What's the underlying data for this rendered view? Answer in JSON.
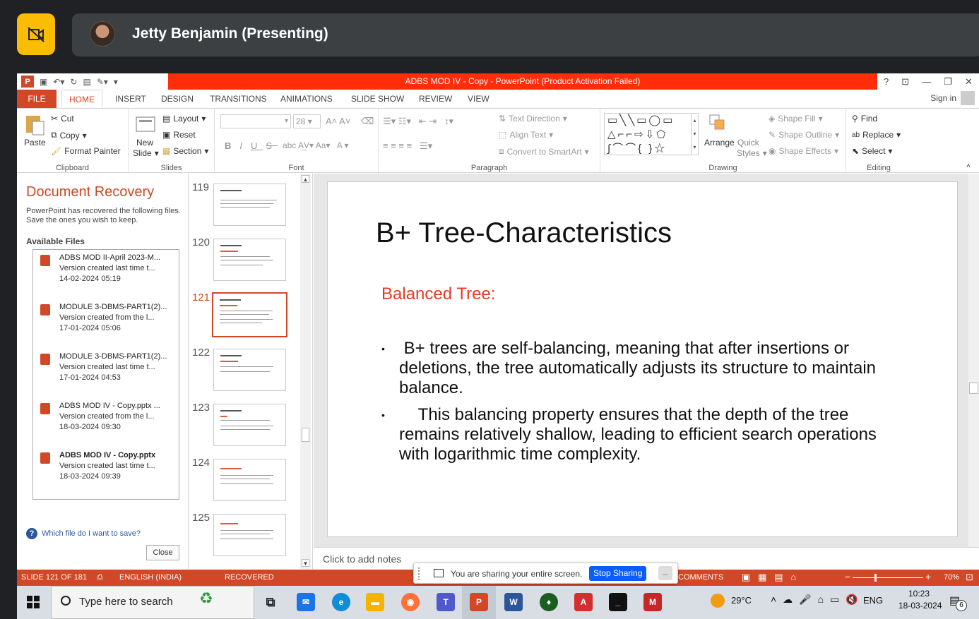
{
  "meeting": {
    "presenter": "Jetty Benjamin (Presenting)"
  },
  "window": {
    "title": "ADBS MOD IV - Copy -  PowerPoint (Product Activation Failed)",
    "help": "?",
    "sign_in": "Sign in"
  },
  "tabs": [
    "FILE",
    "HOME",
    "INSERT",
    "DESIGN",
    "TRANSITIONS",
    "ANIMATIONS",
    "SLIDE SHOW",
    "REVIEW",
    "VIEW"
  ],
  "ribbon": {
    "clipboard": {
      "label": "Clipboard",
      "paste": "Paste",
      "cut": "Cut",
      "copy": "Copy",
      "format_painter": "Format Painter"
    },
    "slides": {
      "label": "Slides",
      "new_slide_1": "New",
      "new_slide_2": "Slide",
      "layout": "Layout",
      "reset": "Reset",
      "section": "Section"
    },
    "font": {
      "label": "Font",
      "size": "28"
    },
    "paragraph": {
      "label": "Paragraph",
      "text_direction": "Text Direction",
      "align_text": "Align Text",
      "convert_smartart": "Convert to SmartArt"
    },
    "drawing": {
      "label": "Drawing",
      "arrange": "Arrange",
      "quick_styles_1": "Quick",
      "quick_styles_2": "Styles",
      "shape_fill": "Shape Fill",
      "shape_outline": "Shape Outline",
      "shape_effects": "Shape Effects"
    },
    "editing": {
      "label": "Editing",
      "find": "Find",
      "replace": "Replace",
      "select": "Select"
    }
  },
  "recovery": {
    "title": "Document Recovery",
    "description": "PowerPoint has recovered the following files.  Save the ones you wish to keep.",
    "available": "Available Files",
    "files": [
      {
        "name": "ADBS MOD II-April 2023-M...",
        "version": "Version created last time t...",
        "date": "14-02-2024 05:19",
        "bold": false
      },
      {
        "name": "MODULE 3-DBMS-PART1(2)...",
        "version": "Version created from the l...",
        "date": "17-01-2024 05:06",
        "bold": false
      },
      {
        "name": "MODULE 3-DBMS-PART1(2)...",
        "version": "Version created last time t...",
        "date": "17-01-2024 04:53",
        "bold": false
      },
      {
        "name": "ADBS MOD IV - Copy.pptx  ...",
        "version": "Version created from the l...",
        "date": "18-03-2024 09:30",
        "bold": false
      },
      {
        "name": "ADBS MOD IV - Copy.pptx",
        "version": "Version created last time t...",
        "date": "18-03-2024 09:39",
        "bold": true
      }
    ],
    "help": "Which file do I want to save?",
    "close": "Close"
  },
  "thumbnails": [
    "119",
    "120",
    "121",
    "122",
    "123",
    "124",
    "125"
  ],
  "slide": {
    "title": "B+ Tree-Characteristics",
    "subtitle": "Balanced Tree:",
    "bullet_1": " B+ trees are self-balancing, meaning that after insertions or deletions, the tree automatically adjusts its structure to maintain balance.",
    "bullet_2": "    This balancing property ensures that the depth of the tree remains relatively shallow, leading to efficient search operations with logarithmic time complexity.",
    "bullet_mark": "•"
  },
  "notes": "Click to add notes",
  "status": {
    "slide": "SLIDE 121 OF 181",
    "language": "ENGLISH (INDIA)",
    "recovered": "RECOVERED",
    "comments": "COMMENTS",
    "zoom": "70%"
  },
  "share": {
    "text": "You are sharing your entire screen.",
    "stop": "Stop Sharing"
  },
  "taskbar": {
    "search": "Type here to search",
    "weather": "29°C",
    "lang": "ENG",
    "time": "10:23",
    "date": "18-03-2024",
    "notifications": "6"
  }
}
